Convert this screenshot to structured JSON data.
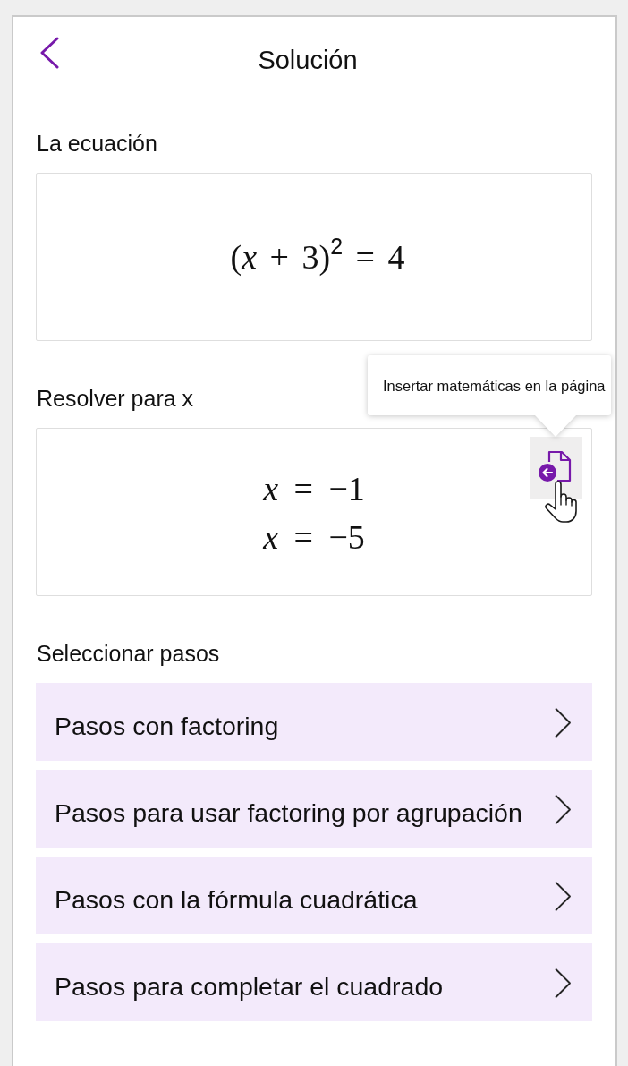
{
  "header": {
    "title": "Solución"
  },
  "equation_section": {
    "label": "La ecuación",
    "equation": "(*x* + 3)$^{2}$ = 4"
  },
  "solve_section": {
    "label": "Resolver para x",
    "solutions": [
      "*x* = −1",
      "*x* = −5"
    ],
    "insert_button": {
      "hovered": true,
      "tooltip": "Insertar matemáticas en la página"
    }
  },
  "steps_section": {
    "label": "Seleccionar pasos",
    "items": [
      {
        "label": "Pasos con factoring"
      },
      {
        "label": "Pasos para usar factoring por agrupación"
      },
      {
        "label": "Pasos con la fórmula cuadrática"
      },
      {
        "label": "Pasos para completar el cuadrado"
      }
    ]
  }
}
